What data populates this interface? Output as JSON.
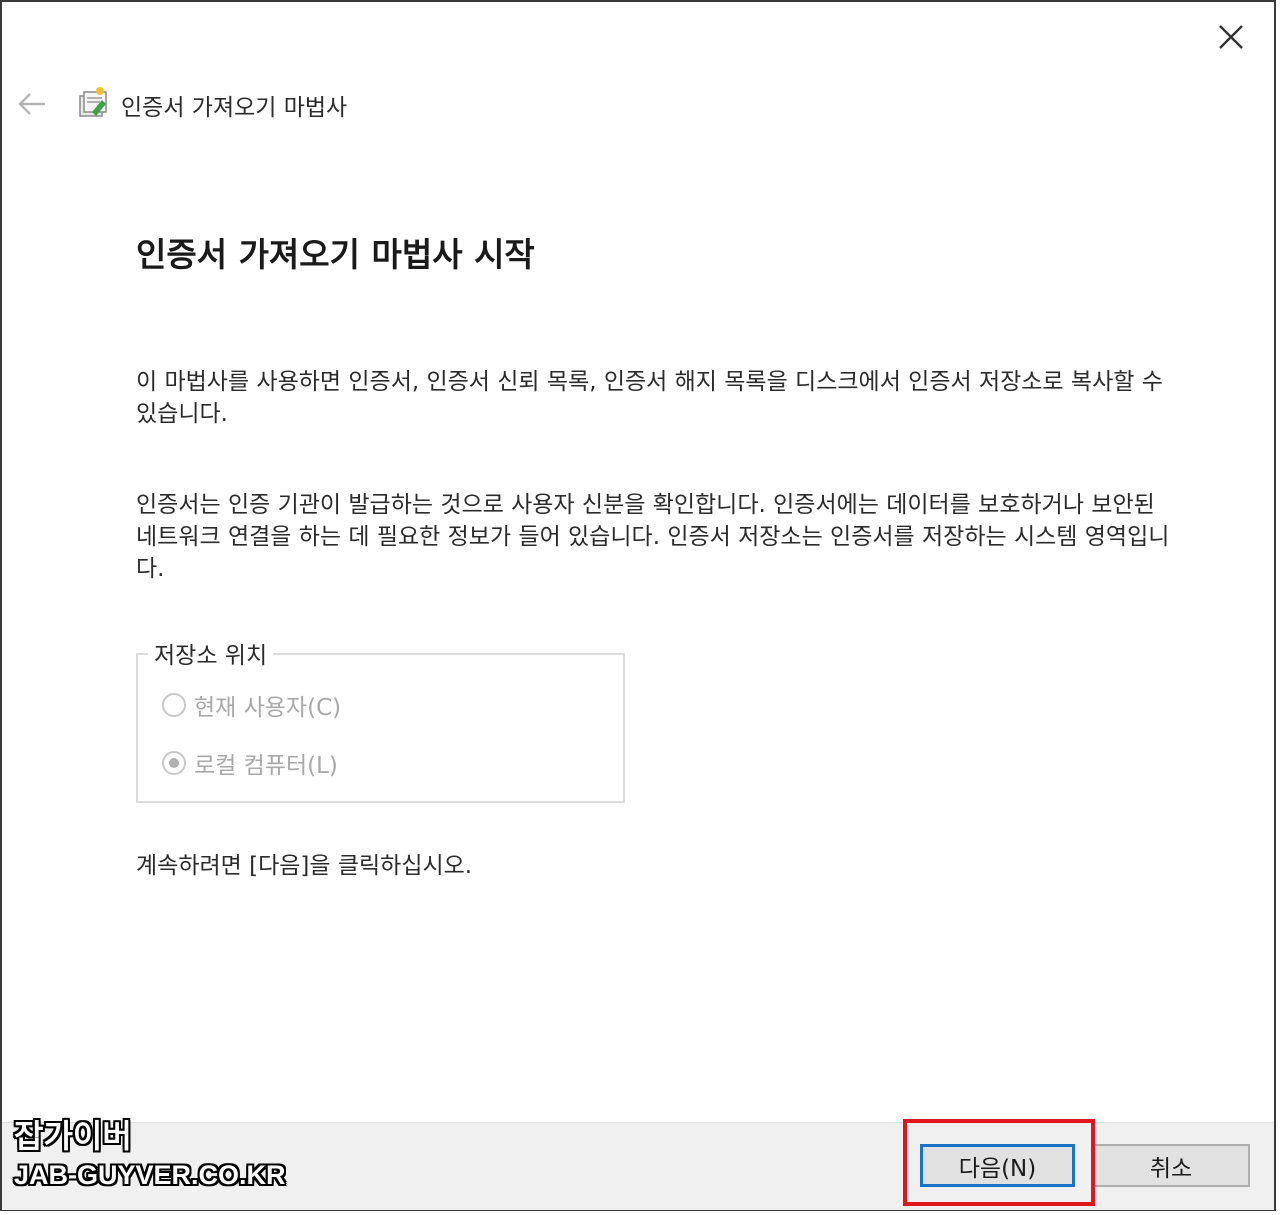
{
  "window": {
    "title": "인증서 가져오기 마법사",
    "close_icon": "close-icon",
    "back_icon": "back-arrow-icon",
    "title_icon": "certificate-wizard-icon"
  },
  "content": {
    "heading": "인증서 가져오기 마법사 시작",
    "paragraph1": "이 마법사를 사용하면 인증서, 인증서 신뢰 목록, 인증서 해지 목록을 디스크에서 인증서 저장소로 복사할 수 있습니다.",
    "paragraph2": "인증서는 인증 기관이 발급하는 것으로 사용자 신분을 확인합니다. 인증서에는 데이터를 보호하거나 보안된 네트워크 연결을 하는 데 필요한 정보가 들어 있습니다. 인증서 저장소는 인증서를 저장하는 시스템 영역입니다.",
    "store_location": {
      "legend": "저장소 위치",
      "options": [
        {
          "label": "현재 사용자(C)",
          "selected": false,
          "enabled": false
        },
        {
          "label": "로컬 컴퓨터(L)",
          "selected": true,
          "enabled": false
        }
      ]
    },
    "continue_text": "계속하려면 [다음]을 클릭하십시오."
  },
  "footer": {
    "next_label": "다음(N)",
    "cancel_label": "취소"
  },
  "watermark": {
    "line1": "잡가이버",
    "line2": "JAB-GUYVER.CO.KR"
  },
  "colors": {
    "highlight": "#e0161f",
    "default_button_border": "#1a73c8"
  }
}
